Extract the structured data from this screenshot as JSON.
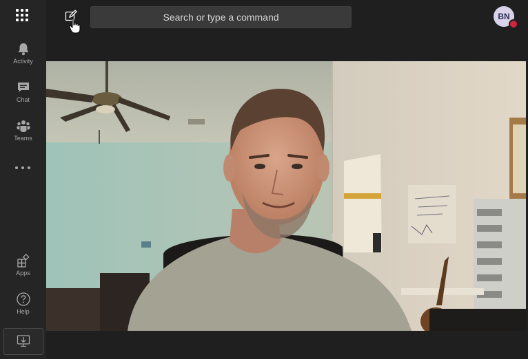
{
  "rail": {
    "items": [
      {
        "label": "Activity",
        "icon": "bell-icon"
      },
      {
        "label": "Chat",
        "icon": "chat-icon"
      },
      {
        "label": "Teams",
        "icon": "teams-icon"
      },
      {
        "label": "Apps",
        "icon": "apps-store-icon"
      },
      {
        "label": "Help",
        "icon": "help-icon"
      }
    ],
    "more_icon": "ellipsis-icon",
    "download_icon": "download-icon"
  },
  "header": {
    "search_placeholder": "Search or type a command",
    "avatar_initials": "BN",
    "presence_color": "#d0253a"
  },
  "video": {
    "content": "webcam-self-view"
  },
  "colors": {
    "rail_bg": "#252526",
    "top_bg": "#1f1f1f",
    "search_bg": "#3a3a3a"
  }
}
